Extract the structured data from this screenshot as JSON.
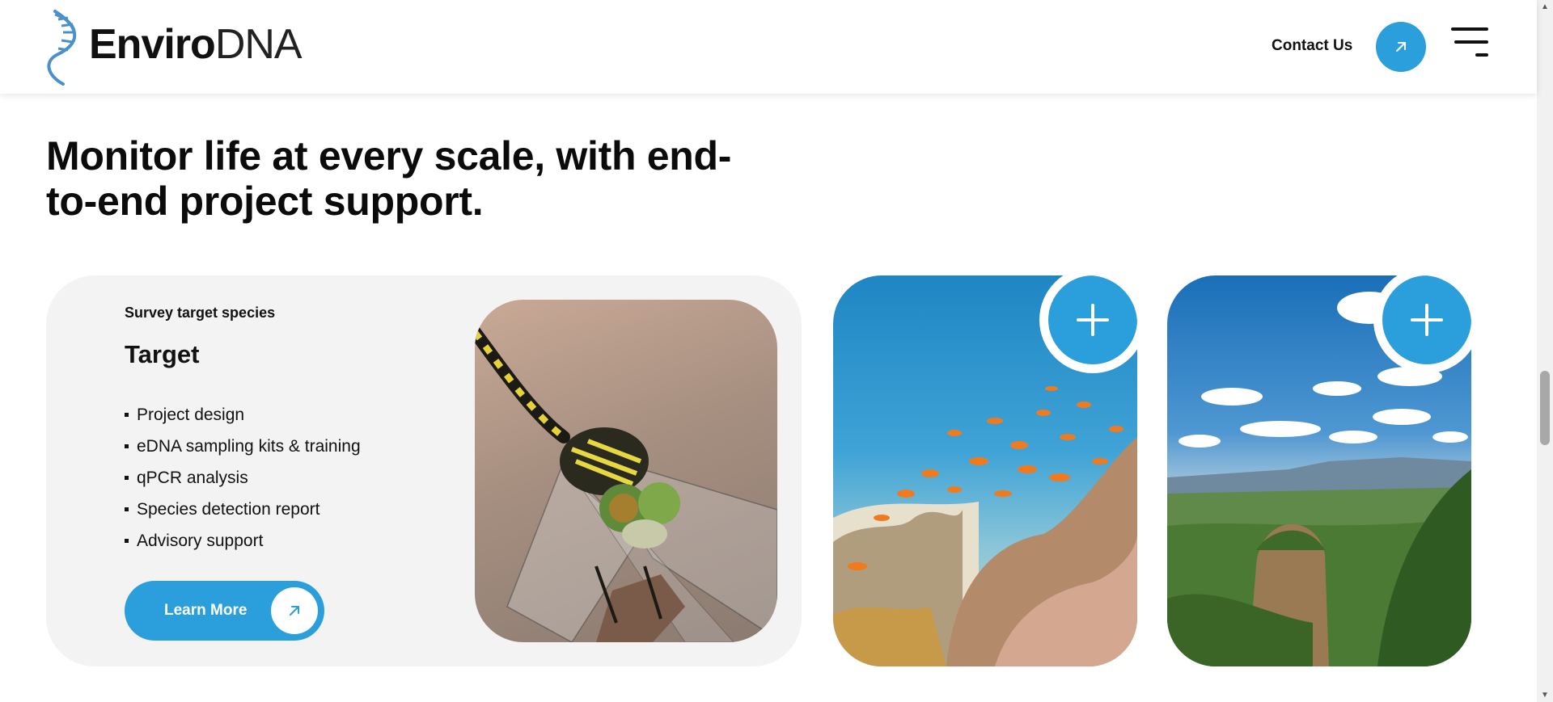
{
  "header": {
    "logo": {
      "bold": "Enviro",
      "light": "DNA"
    },
    "contact_label": "Contact Us",
    "contact_icon": "arrow-up-right-icon",
    "menu_icon": "hamburger-menu-icon"
  },
  "section": {
    "heading_line1": "Monitor life at every scale, with end-",
    "heading_line2": "to-end project support."
  },
  "card": {
    "eyebrow": "Survey target species",
    "title": "Target",
    "features": [
      "Project design",
      "eDNA sampling kits & training",
      "qPCR analysis",
      "Species detection report",
      "Advisory support"
    ],
    "button_label": "Learn More",
    "button_icon": "arrow-up-right-icon",
    "image_subject": "dragonfly"
  },
  "tiles": [
    {
      "image_subject": "coral-reef",
      "icon": "plus-icon"
    },
    {
      "image_subject": "mountain-forest",
      "icon": "plus-icon"
    }
  ],
  "colors": {
    "accent": "#2a9fdc",
    "card_bg": "#f3f3f3",
    "text": "#111111"
  }
}
